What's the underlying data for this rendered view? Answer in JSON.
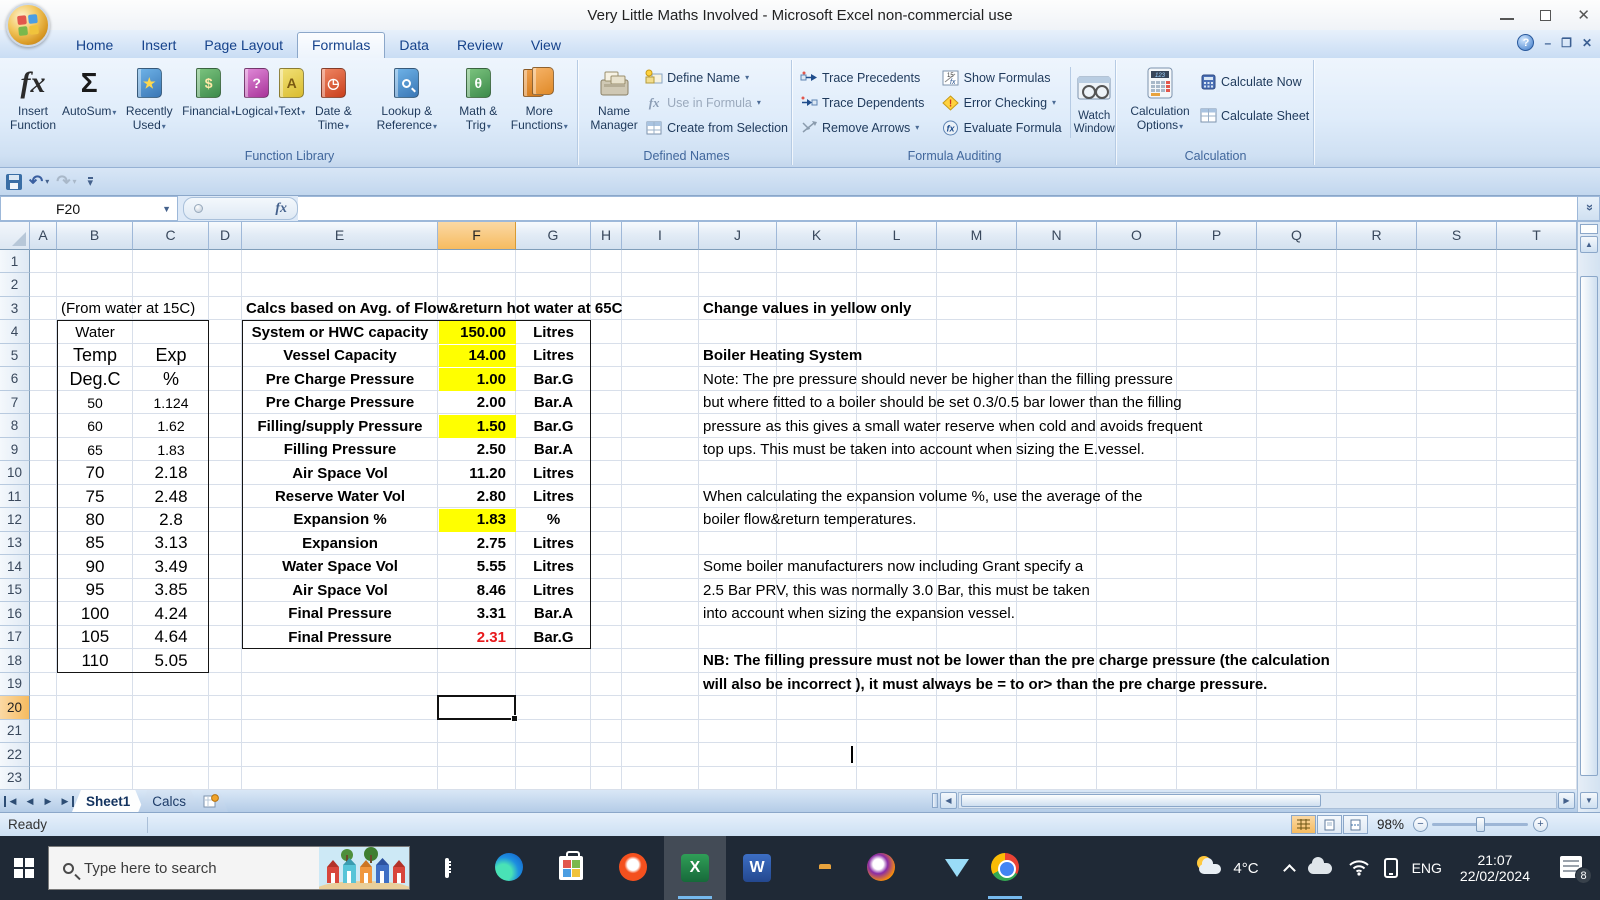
{
  "window": {
    "title": "Very Little Maths Involved - Microsoft Excel non-commercial use"
  },
  "colors": {
    "highlight_yellow": "#ffff00",
    "alert_red": "#e8191c",
    "selection_orange": "#f6bb60"
  },
  "ribbon": {
    "tabs": [
      "Home",
      "Insert",
      "Page Layout",
      "Formulas",
      "Data",
      "Review",
      "View"
    ],
    "active_tab": "Formulas",
    "groups": {
      "function_library": {
        "label": "Function Library",
        "insert_function": "Insert Function",
        "items": [
          {
            "label": "AutoSum",
            "icon": "autosum-icon",
            "arrow": true
          },
          {
            "label": "Recently Used",
            "icon": "recently-used-icon",
            "arrow": true
          },
          {
            "label": "Financial",
            "icon": "financial-icon",
            "arrow": true
          },
          {
            "label": "Logical",
            "icon": "logical-icon",
            "arrow": true
          },
          {
            "label": "Text",
            "icon": "text-icon",
            "arrow": true
          },
          {
            "label": "Date & Time",
            "icon": "date-time-icon",
            "arrow": true
          },
          {
            "label": "Lookup & Reference",
            "icon": "lookup-icon",
            "arrow": true
          },
          {
            "label": "Math & Trig",
            "icon": "math-trig-icon",
            "arrow": true
          },
          {
            "label": "More Functions",
            "icon": "more-functions-icon",
            "arrow": true
          }
        ]
      },
      "defined_names": {
        "label": "Defined Names",
        "name_manager": "Name Manager",
        "items": [
          {
            "label": "Define Name",
            "icon": "define-name-icon",
            "arrow": true
          },
          {
            "label": "Use in Formula",
            "icon": "use-in-formula-icon",
            "arrow": true,
            "disabled": true
          },
          {
            "label": "Create from Selection",
            "icon": "create-from-selection-icon"
          }
        ]
      },
      "formula_auditing": {
        "label": "Formula Auditing",
        "col1": [
          {
            "label": "Trace Precedents",
            "icon": "trace-precedents-icon"
          },
          {
            "label": "Trace Dependents",
            "icon": "trace-dependents-icon"
          },
          {
            "label": "Remove Arrows",
            "icon": "remove-arrows-icon",
            "arrow": true
          }
        ],
        "col2": [
          {
            "label": "Show Formulas",
            "icon": "show-formulas-icon"
          },
          {
            "label": "Error Checking",
            "icon": "error-checking-icon",
            "arrow": true
          },
          {
            "label": "Evaluate Formula",
            "icon": "evaluate-formula-icon"
          }
        ],
        "watch_window": "Watch Window"
      },
      "calculation": {
        "label": "Calculation",
        "calculation_options": "Calculation Options",
        "items": [
          {
            "label": "Calculate Now",
            "icon": "calculate-now-icon"
          },
          {
            "label": "Calculate Sheet",
            "icon": "calculate-sheet-icon"
          }
        ]
      }
    }
  },
  "formula_bar": {
    "name_box": "F20",
    "fx": "fx",
    "value": ""
  },
  "sheet": {
    "columns": [
      "A",
      "B",
      "C",
      "D",
      "E",
      "F",
      "G",
      "H",
      "I",
      "J",
      "K",
      "L",
      "M",
      "N",
      "O",
      "P",
      "Q",
      "R",
      "S",
      "T"
    ],
    "selected_cell": "F20",
    "selected_column": "F",
    "selected_row": 20,
    "row_count": 23,
    "water_table": {
      "note": "(From water at 15C)",
      "title": "Water",
      "col_headers": [
        "Temp",
        "Exp"
      ],
      "unit_headers": [
        "Deg.C",
        "%"
      ],
      "rows": [
        [
          "50",
          "1.124"
        ],
        [
          "60",
          "1.62"
        ],
        [
          "65",
          "1.83"
        ],
        [
          "70",
          "2.18"
        ],
        [
          "75",
          "2.48"
        ],
        [
          "80",
          "2.8"
        ],
        [
          "85",
          "3.13"
        ],
        [
          "90",
          "3.49"
        ],
        [
          "95",
          "3.85"
        ],
        [
          "100",
          "4.24"
        ],
        [
          "105",
          "4.64"
        ],
        [
          "110",
          "5.05"
        ]
      ]
    },
    "calc_table": {
      "title": "Calcs based on Avg. of Flow&return hot water at 65C",
      "rows": [
        {
          "label": "System or HWC capacity",
          "value": "150.00",
          "unit": "Litres",
          "highlight": true
        },
        {
          "label": "Vessel Capacity",
          "value": "14.00",
          "unit": "Litres",
          "highlight": true
        },
        {
          "label": "Pre Charge Pressure",
          "value": "1.00",
          "unit": "Bar.G",
          "highlight": true
        },
        {
          "label": "Pre Charge Pressure",
          "value": "2.00",
          "unit": "Bar.A"
        },
        {
          "label": "Filling/supply Pressure",
          "value": "1.50",
          "unit": "Bar.G",
          "highlight": true
        },
        {
          "label": "Filling Pressure",
          "value": "2.50",
          "unit": "Bar.A"
        },
        {
          "label": "Air Space Vol",
          "value": "11.20",
          "unit": "Litres"
        },
        {
          "label": "Reserve Water Vol",
          "value": "2.80",
          "unit": "Litres"
        },
        {
          "label": "Expansion %",
          "value": "1.83",
          "unit": "%",
          "highlight": true
        },
        {
          "label": "Expansion",
          "value": "2.75",
          "unit": "Litres"
        },
        {
          "label": "Water Space Vol",
          "value": "5.55",
          "unit": "Litres"
        },
        {
          "label": "Air Space Vol",
          "value": "8.46",
          "unit": "Litres"
        },
        {
          "label": "Final Pressure",
          "value": "3.31",
          "unit": "Bar.A"
        },
        {
          "label": "Final Pressure",
          "value": "2.31",
          "unit": "Bar.G",
          "red": true
        }
      ]
    },
    "notes": [
      {
        "row": 3,
        "text": "Change values in yellow only",
        "bold": true
      },
      {
        "row": 5,
        "text": "Boiler Heating System",
        "bold": true
      },
      {
        "row": 6,
        "text": "Note: The pre pressure should never be higher than the filling pressure"
      },
      {
        "row": 7,
        "text": "but where fitted to a boiler should be set 0.3/0.5 bar lower than the filling"
      },
      {
        "row": 8,
        "text": "pressure as this gives a small water reserve when cold and avoids frequent"
      },
      {
        "row": 9,
        "text": "top ups. This must be taken into account when sizing the E.vessel."
      },
      {
        "row": 11,
        "text": "When calculating the expansion volume %, use the average of the"
      },
      {
        "row": 12,
        "text": "boiler flow&return temperatures."
      },
      {
        "row": 14,
        "text": "Some boiler manufacturers now including Grant specify a"
      },
      {
        "row": 15,
        "text": "2.5 Bar PRV, this was normally 3.0 Bar, this must be taken"
      },
      {
        "row": 16,
        "text": "into account when sizing the expansion vessel."
      },
      {
        "row": 18,
        "text": "NB: The filling pressure must not be lower than the pre charge pressure (the calculation",
        "bold": true
      },
      {
        "row": 19,
        "text": "will also be incorrect ), it must always be = to or> than the pre charge pressure.",
        "bold": true
      }
    ]
  },
  "sheet_tabs": {
    "tabs": [
      "Sheet1",
      "Calcs"
    ],
    "active": "Sheet1"
  },
  "status_bar": {
    "mode": "Ready",
    "zoom": "98%"
  },
  "taskbar": {
    "search_placeholder": "Type here to search",
    "apps": [
      {
        "icon": "task-view-icon"
      },
      {
        "icon": "edge-icon"
      },
      {
        "icon": "store-icon"
      },
      {
        "icon": "brave-icon"
      },
      {
        "icon": "excel-icon",
        "active": true,
        "focused": true
      },
      {
        "icon": "word-icon"
      },
      {
        "icon": "file-explorer-icon"
      },
      {
        "icon": "firefox-icon"
      },
      {
        "icon": "mail-icon"
      },
      {
        "icon": "chrome-icon",
        "active": true
      }
    ],
    "temperature": "4°C",
    "language": "ENG",
    "time": "21:07",
    "date": "22/02/2024",
    "notification_count": "8"
  }
}
